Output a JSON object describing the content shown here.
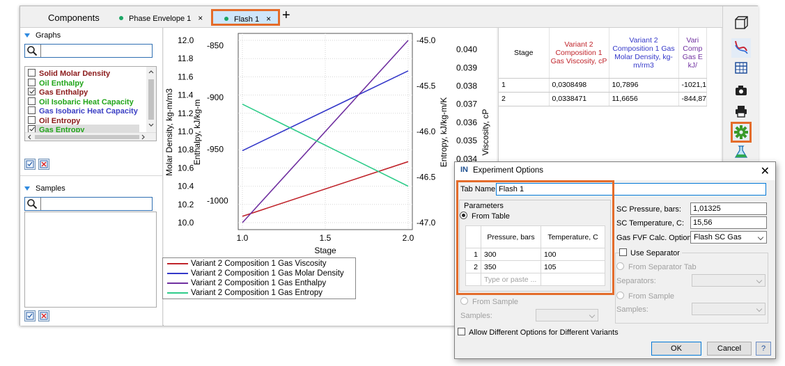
{
  "tabs": {
    "components": "Components",
    "phase_envelope": "Phase Envelope 1",
    "flash": "Flash 1",
    "close": "×",
    "add": "+"
  },
  "left": {
    "graphs_title": "Graphs",
    "samples_title": "Samples",
    "graph_items": [
      {
        "label": "Solid Molar Density",
        "color": "#8b1a1a",
        "checked": false
      },
      {
        "label": "Oil Enthalpy",
        "color": "#22a51a",
        "checked": false
      },
      {
        "label": "Gas Enthalpy",
        "color": "#8b1a1a",
        "checked": true
      },
      {
        "label": "Oil Isobaric Heat Capacity",
        "color": "#22a51a",
        "checked": false
      },
      {
        "label": "Gas Isobaric Heat Capacity",
        "color": "#3b3fc4",
        "checked": false
      },
      {
        "label": "Oil Entropy",
        "color": "#8b1a1a",
        "checked": false
      },
      {
        "label": "Gas Entropy",
        "color": "#22a51a",
        "checked": true
      }
    ]
  },
  "chart_data": {
    "type": "line",
    "xlabel": "Stage",
    "x": [
      1.0,
      2.0
    ],
    "x_ticks": [
      "1.0",
      "1.5",
      "2.0"
    ],
    "axes": [
      {
        "label": "Molar Density, kg-m/m3",
        "ticks": [
          "12.0",
          "11.8",
          "11.6",
          "11.4",
          "11.2",
          "11.0",
          "10.8",
          "10.6",
          "10.4",
          "10.2",
          "10.0"
        ],
        "range": [
          10.0,
          12.0
        ]
      },
      {
        "label": "Enthalpy, kJ/kg-m",
        "ticks": [
          "-850",
          "-900",
          "-950",
          "-1000"
        ],
        "range": [
          -1021.1,
          -844.87
        ]
      },
      {
        "label": "Entropy, kJ/kg-m/K",
        "ticks": [
          "-45.0",
          "-45.5",
          "-46.0",
          "-46.5",
          "-47.0"
        ],
        "range": [
          -47.0,
          -45.0
        ]
      },
      {
        "label": "Viscosity, cP",
        "ticks": [
          "0.040",
          "0.039",
          "0.038",
          "0.037",
          "0.036",
          "0.035",
          "0.034"
        ],
        "range": [
          0.0305,
          0.0405
        ]
      }
    ],
    "series": [
      {
        "name": "Variant 2 Composition 1 Gas Viscosity",
        "color": "#c0242b",
        "values": [
          0.0308498,
          0.0338471
        ]
      },
      {
        "name": "Variant 2 Composition 1 Gas Molar Density",
        "color": "#3438c9",
        "values": [
          10.7896,
          11.6656
        ]
      },
      {
        "name": "Variant 2 Composition 1 Gas Enthalpy",
        "color": "#7030a0",
        "values": [
          -1021.1,
          -844.87
        ]
      },
      {
        "name": "Variant 2 Composition 1 Gas Entropy",
        "color": "#2ecc8a",
        "values": [
          -45.7,
          -46.6
        ]
      }
    ]
  },
  "table": {
    "headers": [
      "Stage",
      "Variant 2 Composition 1 Gas Viscosity, cP",
      "Variant 2 Composition 1 Gas Molar Density, kg-m/rm3",
      "Vari Comp Gas E kJ/"
    ],
    "rows": [
      [
        "1",
        "0,0308498",
        "10,7896",
        "-1021,1"
      ],
      [
        "2",
        "0,0338471",
        "11,6656",
        "-844,87"
      ]
    ]
  },
  "dialog": {
    "title": "Experiment Options",
    "logo": "IN",
    "tab_name_label": "Tab Name:",
    "tab_name_value": "Flash 1",
    "parameters": "Parameters",
    "from_table": "From Table",
    "col_pressure": "Pressure, bars",
    "col_temperature": "Temperature, C",
    "param_rows": [
      {
        "n": "1",
        "p": "300",
        "t": "100"
      },
      {
        "n": "2",
        "p": "350",
        "t": "105"
      }
    ],
    "type_placeholder": "Type or paste ...",
    "from_sample": "From Sample",
    "samples_label": "Samples:",
    "sc_pressure_label": "SC Pressure, bars:",
    "sc_pressure_value": "1,01325",
    "sc_temp_label": "SC Temperature, C:",
    "sc_temp_value": "15,56",
    "fvf_label": "Gas FVF Calc. Options:",
    "fvf_value": "Flash SC Gas",
    "use_separator": "Use Separator",
    "from_sep_tab": "From Separator Tab",
    "separators_label": "Separators:",
    "from_sample_right": "From Sample",
    "samples_label_right": "Samples:",
    "allow_diff": "Allow Different Options for Different Variants",
    "ok": "OK",
    "cancel": "Cancel",
    "help": "?"
  }
}
